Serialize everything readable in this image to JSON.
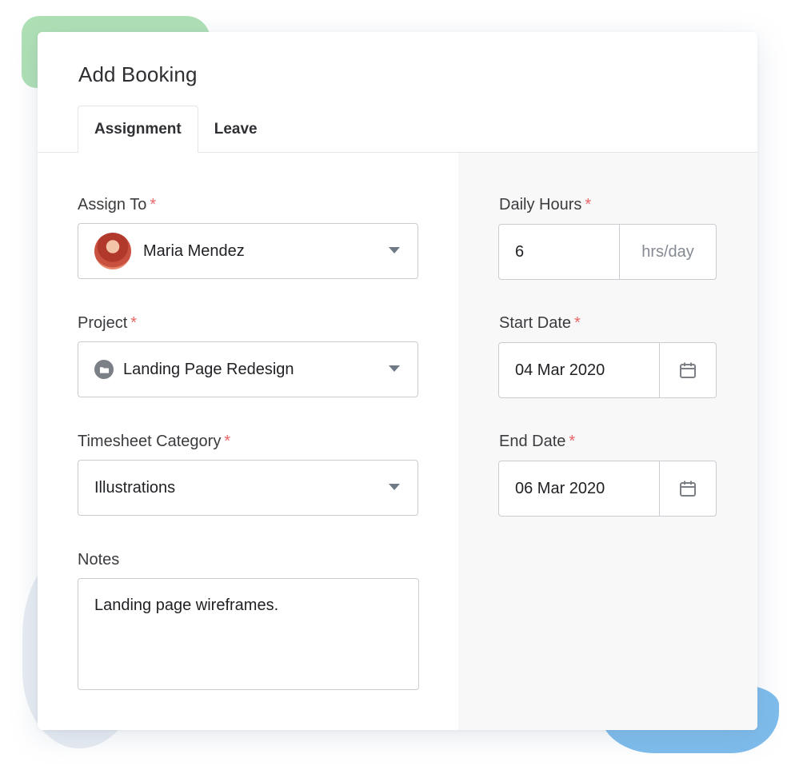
{
  "dialog": {
    "title": "Add Booking",
    "tabs": [
      {
        "label": "Assignment",
        "active": true
      },
      {
        "label": "Leave",
        "active": false
      }
    ]
  },
  "form": {
    "assign_to": {
      "label": "Assign To",
      "required_mark": "*",
      "value": "Maria Mendez",
      "icon": "user-avatar"
    },
    "project": {
      "label": "Project",
      "required_mark": "*",
      "value": "Landing Page Redesign",
      "icon": "folder-icon"
    },
    "timesheet_category": {
      "label": "Timesheet Category",
      "required_mark": "*",
      "value": "Illustrations"
    },
    "notes": {
      "label": "Notes",
      "value": "Landing page wireframes."
    },
    "daily_hours": {
      "label": "Daily Hours",
      "required_mark": "*",
      "value": "6",
      "unit": "hrs/day"
    },
    "start_date": {
      "label": "Start Date",
      "required_mark": "*",
      "value": "04 Mar 2020",
      "icon": "calendar-icon"
    },
    "end_date": {
      "label": "End Date",
      "required_mark": "*",
      "value": "06 Mar 2020",
      "icon": "calendar-icon"
    }
  },
  "colors": {
    "required": "#e86666",
    "border": "#c9ccd1",
    "right_panel_bg": "#f8f8f8",
    "caret": "#6f7a86"
  }
}
